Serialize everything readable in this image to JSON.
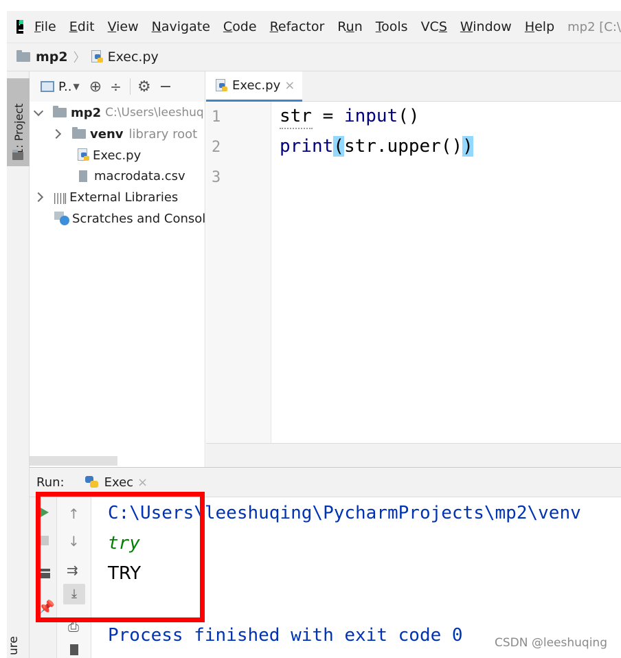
{
  "menubar": {
    "items": [
      {
        "label": "File",
        "mnemonic": "F",
        "rest": "ile"
      },
      {
        "label": "Edit",
        "mnemonic": "E",
        "rest": "dit"
      },
      {
        "label": "View",
        "mnemonic": "V",
        "rest": "iew"
      },
      {
        "label": "Navigate",
        "mnemonic": "N",
        "rest": "avigate"
      },
      {
        "label": "Code",
        "mnemonic": "C",
        "rest": "ode"
      },
      {
        "label": "Refactor",
        "mnemonic": "R",
        "rest": "efactor"
      },
      {
        "label": "Run",
        "pre": "R",
        "mnemonic": "u",
        "rest": "n"
      },
      {
        "label": "Tools",
        "mnemonic": "T",
        "rest": "ools"
      },
      {
        "label": "VCS",
        "pre": "VC",
        "mnemonic": "S",
        "rest": ""
      },
      {
        "label": "Window",
        "mnemonic": "W",
        "rest": "indow"
      },
      {
        "label": "Help",
        "mnemonic": "H",
        "rest": "elp"
      }
    ],
    "project_title": "mp2 [C:\\"
  },
  "breadcrumb": {
    "project": "mp2",
    "file": "Exec.py"
  },
  "left_strip": {
    "project_tab": "1: Project",
    "structure_tab": "ure"
  },
  "project_panel": {
    "view_label": "P..",
    "tree": {
      "root_name": "mp2",
      "root_path": "C:\\Users\\leeshuq",
      "venv_name": "venv",
      "venv_note": "library root",
      "file1": "Exec.py",
      "file2": "macrodata.csv",
      "external": "External Libraries",
      "scratches": "Scratches and Consol"
    }
  },
  "editor": {
    "tab_label": "Exec.py",
    "line_numbers": [
      "1",
      "2",
      "3"
    ],
    "line1": {
      "var": "str",
      "op": " = ",
      "fn": "input",
      "args": "()"
    },
    "line2": {
      "fn": "print",
      "open": "(",
      "mid": "str.upper()",
      "close": ")"
    }
  },
  "run_panel": {
    "label": "Run:",
    "config_name": "Exec",
    "console": {
      "command": "C:\\Users\\leeshuqing\\PycharmProjects\\mp2\\venv",
      "input_echo": "try",
      "output": "TRY",
      "exit_message": "Process finished with exit code 0"
    }
  },
  "watermark": "CSDN @leeshuqing",
  "colors": {
    "accent": "#4083c9",
    "highlight_box": "#ff0000",
    "run_green": "#499c54",
    "keyword_fn": "#000080",
    "console_blue": "#0033b3",
    "input_green": "#008000",
    "brace_match": "#93d9ff"
  }
}
